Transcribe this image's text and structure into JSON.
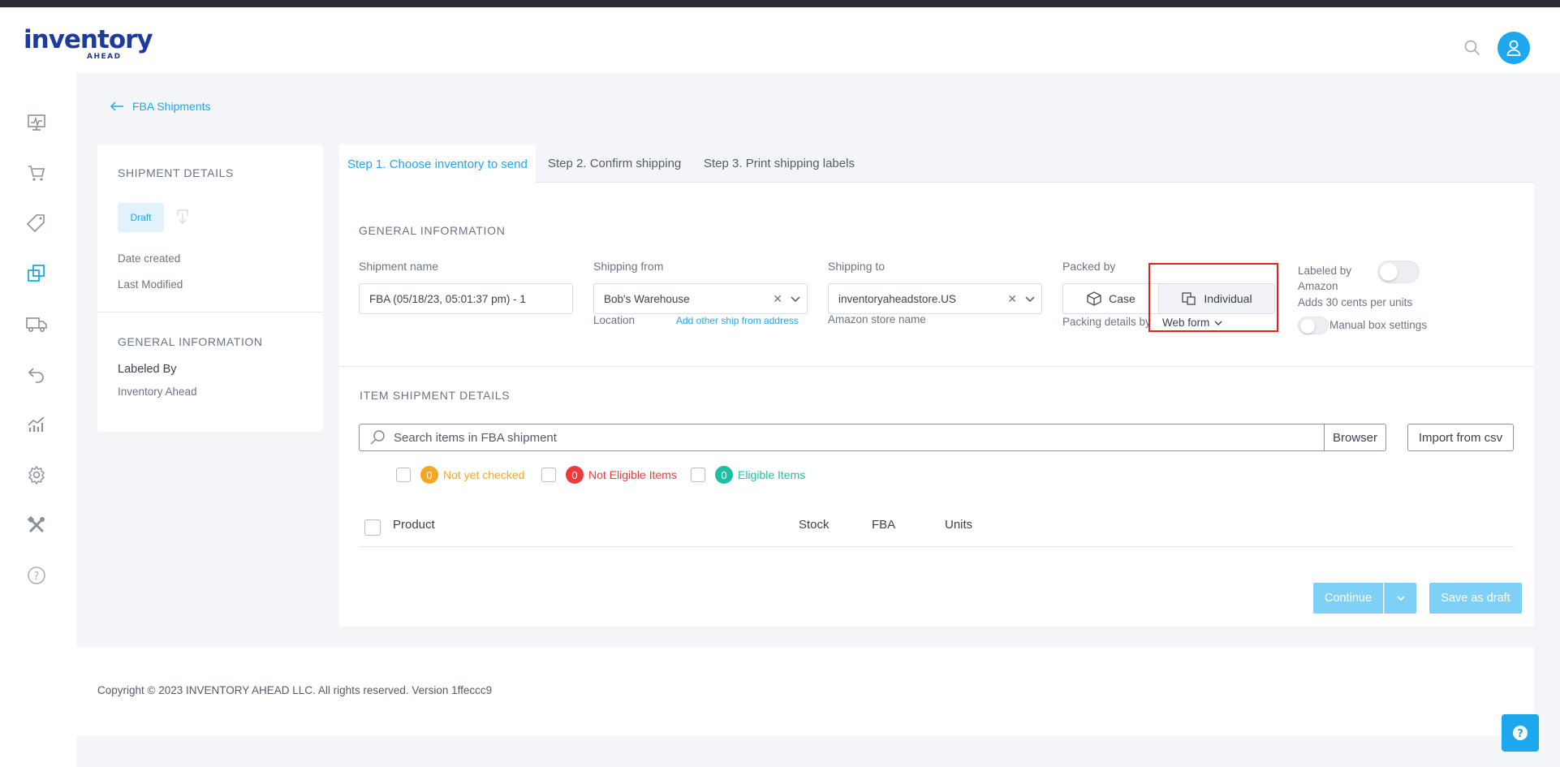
{
  "brand": {
    "name": "inventory",
    "sub": "AHEAD"
  },
  "colors": {
    "accent": "#1da7ec",
    "brand": "#1f3a9e",
    "warning": "#f5a623",
    "danger": "#f03a3a",
    "success": "#1fbfa4"
  },
  "breadcrumb": {
    "back_label": "FBA Shipments"
  },
  "sidebar": {
    "items": [
      {
        "icon": "dashboard-icon"
      },
      {
        "icon": "cart-icon"
      },
      {
        "icon": "tag-icon"
      },
      {
        "icon": "shipments-icon",
        "active": true
      },
      {
        "icon": "truck-icon"
      },
      {
        "icon": "return-icon"
      },
      {
        "icon": "analytics-icon"
      },
      {
        "icon": "gear-icon"
      },
      {
        "icon": "tools-icon"
      },
      {
        "icon": "help-icon"
      }
    ]
  },
  "left_panel": {
    "shipment_details_title": "SHIPMENT DETAILS",
    "status_badge": "Draft",
    "date_created_label": "Date created",
    "last_modified_label": "Last Modified",
    "general_info_title": "GENERAL INFORMATION",
    "labeled_by_label": "Labeled By",
    "labeled_by_value": "Inventory Ahead"
  },
  "tabs": [
    {
      "label": "Step 1. Choose inventory to send",
      "active": true
    },
    {
      "label": "Step 2. Confirm shipping"
    },
    {
      "label": "Step 3. Print shipping labels"
    }
  ],
  "general": {
    "title": "GENERAL INFORMATION",
    "shipment_name_label": "Shipment name",
    "shipment_name_value": "FBA (05/18/23, 05:01:37 pm) - 1",
    "shipping_from_label": "Shipping from",
    "shipping_from_value": "Bob's Warehouse",
    "location_label": "Location",
    "add_ship_from_link": "Add other ship from address",
    "shipping_to_label": "Shipping to",
    "shipping_to_value": "inventoryaheadstore.US",
    "amazon_store_label": "Amazon store name",
    "packed_by_label": "Packed by",
    "packed_case": "Case",
    "packed_individual": "Individual",
    "packing_details_label": "Packing details by",
    "packing_details_value": "Web form",
    "labeled_by_amazon_label": "Labeled by Amazon",
    "labeled_by_amazon_on": false,
    "adds_cents_note": "Adds 30 cents per units",
    "manual_box_label": "Manual box settings",
    "manual_box_on": false
  },
  "items": {
    "title": "ITEM SHIPMENT DETAILS",
    "search_placeholder": "Search items in FBA shipment",
    "browser_label": "Browser",
    "import_label": "Import from csv",
    "filters": [
      {
        "count": "0",
        "label": "Not yet checked"
      },
      {
        "count": "0",
        "label": "Not Eligible Items"
      },
      {
        "count": "0",
        "label": "Eligible Items"
      }
    ],
    "columns": [
      "Product",
      "Stock",
      "FBA",
      "Units"
    ]
  },
  "actions": {
    "continue_label": "Continue",
    "save_draft_label": "Save as draft"
  },
  "footer": {
    "copyright": "Copyright © 2023 INVENTORY AHEAD LLC. All rights reserved. Version 1ffeccc9"
  }
}
